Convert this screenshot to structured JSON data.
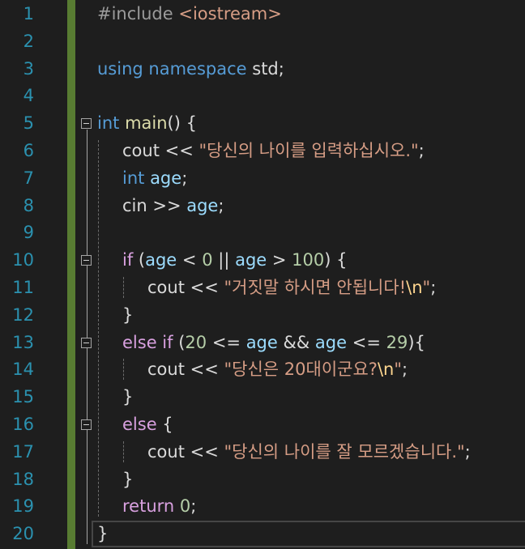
{
  "editor": {
    "lines": [
      {
        "n": "1",
        "indent": 0,
        "tokens": [
          {
            "t": "#include ",
            "c": "pp"
          },
          {
            "t": "<iostream>",
            "c": "inc"
          }
        ]
      },
      {
        "n": "2",
        "indent": 0,
        "tokens": []
      },
      {
        "n": "3",
        "indent": 0,
        "tokens": [
          {
            "t": "using namespace ",
            "c": "kw"
          },
          {
            "t": "std;",
            "c": "txt"
          }
        ]
      },
      {
        "n": "4",
        "indent": 0,
        "tokens": []
      },
      {
        "n": "5",
        "indent": 0,
        "tokens": [
          {
            "t": "int ",
            "c": "kw"
          },
          {
            "t": "main",
            "c": "fn"
          },
          {
            "t": "() {",
            "c": "txt"
          }
        ]
      },
      {
        "n": "6",
        "indent": 1,
        "tokens": [
          {
            "t": "cout << ",
            "c": "txt"
          },
          {
            "t": "\"당신의 나이를 입력하십시오.\"",
            "c": "str"
          },
          {
            "t": ";",
            "c": "txt"
          }
        ]
      },
      {
        "n": "7",
        "indent": 1,
        "tokens": [
          {
            "t": "int ",
            "c": "kw"
          },
          {
            "t": "age",
            "c": "var"
          },
          {
            "t": ";",
            "c": "txt"
          }
        ]
      },
      {
        "n": "8",
        "indent": 1,
        "tokens": [
          {
            "t": "cin >> ",
            "c": "txt"
          },
          {
            "t": "age",
            "c": "var"
          },
          {
            "t": ";",
            "c": "txt"
          }
        ]
      },
      {
        "n": "9",
        "indent": 0,
        "tokens": []
      },
      {
        "n": "10",
        "indent": 1,
        "tokens": [
          {
            "t": "if ",
            "c": "ctl"
          },
          {
            "t": "(",
            "c": "txt"
          },
          {
            "t": "age",
            "c": "var"
          },
          {
            "t": " < ",
            "c": "txt"
          },
          {
            "t": "0",
            "c": "num"
          },
          {
            "t": " || ",
            "c": "txt"
          },
          {
            "t": "age",
            "c": "var"
          },
          {
            "t": " > ",
            "c": "txt"
          },
          {
            "t": "100",
            "c": "num"
          },
          {
            "t": ") {",
            "c": "txt"
          }
        ]
      },
      {
        "n": "11",
        "indent": 2,
        "tokens": [
          {
            "t": "cout << ",
            "c": "txt"
          },
          {
            "t": "\"거짓말 하시면 안됩니다!",
            "c": "str"
          },
          {
            "t": "\\n",
            "c": "esc"
          },
          {
            "t": "\"",
            "c": "str"
          },
          {
            "t": ";",
            "c": "txt"
          }
        ]
      },
      {
        "n": "12",
        "indent": 1,
        "tokens": [
          {
            "t": "}",
            "c": "txt"
          }
        ]
      },
      {
        "n": "13",
        "indent": 1,
        "tokens": [
          {
            "t": "else if ",
            "c": "ctl"
          },
          {
            "t": "(",
            "c": "txt"
          },
          {
            "t": "20",
            "c": "num"
          },
          {
            "t": " <= ",
            "c": "txt"
          },
          {
            "t": "age",
            "c": "var"
          },
          {
            "t": " && ",
            "c": "txt"
          },
          {
            "t": "age",
            "c": "var"
          },
          {
            "t": " <= ",
            "c": "txt"
          },
          {
            "t": "29",
            "c": "num"
          },
          {
            "t": "){",
            "c": "txt"
          }
        ]
      },
      {
        "n": "14",
        "indent": 2,
        "tokens": [
          {
            "t": "cout << ",
            "c": "txt"
          },
          {
            "t": "\"당신은 20대이군요?",
            "c": "str"
          },
          {
            "t": "\\n",
            "c": "esc"
          },
          {
            "t": "\"",
            "c": "str"
          },
          {
            "t": ";",
            "c": "txt"
          }
        ]
      },
      {
        "n": "15",
        "indent": 1,
        "tokens": [
          {
            "t": "}",
            "c": "txt"
          }
        ]
      },
      {
        "n": "16",
        "indent": 1,
        "tokens": [
          {
            "t": "else ",
            "c": "ctl"
          },
          {
            "t": "{",
            "c": "txt"
          }
        ]
      },
      {
        "n": "17",
        "indent": 2,
        "tokens": [
          {
            "t": "cout << ",
            "c": "txt"
          },
          {
            "t": "\"당신의 나이를 잘 모르겠습니다.\"",
            "c": "str"
          },
          {
            "t": ";",
            "c": "txt"
          }
        ]
      },
      {
        "n": "18",
        "indent": 1,
        "tokens": [
          {
            "t": "}",
            "c": "txt"
          }
        ]
      },
      {
        "n": "19",
        "indent": 1,
        "tokens": [
          {
            "t": "return ",
            "c": "ctl"
          },
          {
            "t": "0",
            "c": "num"
          },
          {
            "t": ";",
            "c": "txt"
          }
        ]
      },
      {
        "n": "20",
        "indent": 0,
        "tokens": [
          {
            "t": "}",
            "c": "txt"
          }
        ]
      }
    ],
    "fold_lines": [
      5,
      10,
      13,
      16
    ],
    "current_line": 20
  }
}
